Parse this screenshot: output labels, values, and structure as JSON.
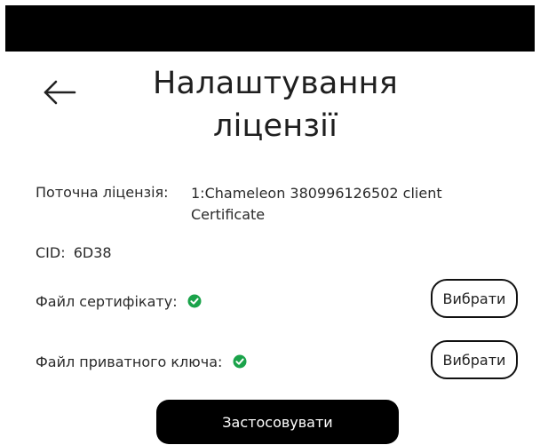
{
  "header": {
    "back_icon": "arrow-left-icon",
    "title_line1": "Налаштування",
    "title_line2": "ліцензії"
  },
  "license": {
    "current_label": "Поточна ліцензія:",
    "current_value_line1": "1:Chameleon 380996126502 client",
    "current_value_line2": "Certificate",
    "cid_label": "CID:",
    "cid_value": "6D38"
  },
  "files": {
    "certificate_label": "Файл сертифікату:",
    "certificate_status_icon": "check-circle-icon",
    "private_key_label": "Файл приватного ключа:",
    "private_key_status_icon": "check-circle-icon",
    "pick_label": "Вибрати"
  },
  "actions": {
    "apply_label": "Застосовувати"
  },
  "colors": {
    "top_bar": "#000000",
    "check": "#1aa34a",
    "apply_button_bg": "#000000",
    "apply_button_text": "#ffffff"
  }
}
